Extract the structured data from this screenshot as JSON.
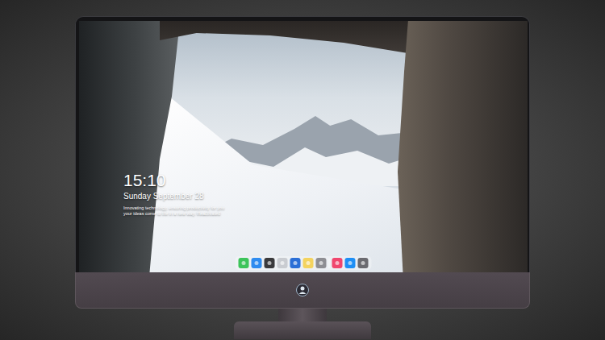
{
  "screen": {
    "clock": {
      "time": "15:10",
      "date": "Sunday September 28",
      "lines": [
        "Innovating technology, ensuring productivity for you",
        "your ideas come to life in a new way. Reactivated"
      ]
    }
  },
  "dock": {
    "items": [
      {
        "kind": "app",
        "color": "#3cc45a"
      },
      {
        "kind": "app",
        "color": "#2f8cf0"
      },
      {
        "kind": "app",
        "color": "#3a3a3c"
      },
      {
        "kind": "app",
        "color": "#c9ccd1"
      },
      {
        "kind": "app",
        "color": "#2b6fd6"
      },
      {
        "kind": "app",
        "color": "#f4d35e"
      },
      {
        "kind": "app",
        "color": "#8e8e93"
      },
      {
        "kind": "separator",
        "color": "#ffffff"
      },
      {
        "kind": "app",
        "color": "#f0466e"
      },
      {
        "kind": "app",
        "color": "#1e8ff5"
      },
      {
        "kind": "app",
        "color": "#6b6b70"
      }
    ]
  }
}
